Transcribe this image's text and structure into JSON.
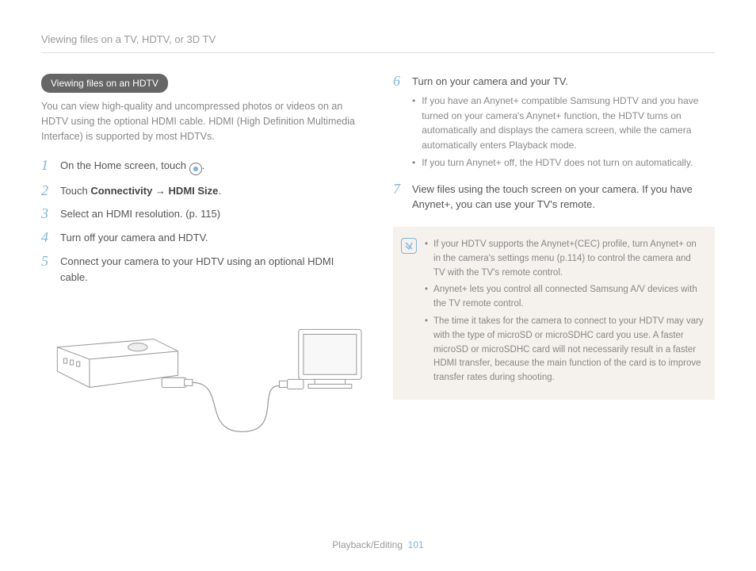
{
  "header": "Viewing files on a TV, HDTV, or 3D TV",
  "pill": "Viewing files on an HDTV",
  "intro": "You can view high-quality and uncompressed photos or videos on an HDTV using the optional HDMI cable. HDMI (High Definition Multimedia Interface) is supported by most HDTVs.",
  "steps": {
    "s1_a": "On the Home screen, touch ",
    "s1_b": ".",
    "s2_a": "Touch ",
    "s2_bold": "Connectivity → HDMI Size",
    "s2_b": ".",
    "s3": "Select an HDMI resolution. (p. 115)",
    "s4": "Turn off your camera and HDTV.",
    "s5": "Connect your camera to your HDTV using an optional HDMI cable.",
    "s6": "Turn on your camera and your TV.",
    "s6_sub1": "If you have an Anynet+ compatible Samsung HDTV and you have turned on your camera's Anynet+ function, the HDTV turns on automatically and displays the camera screen, while the camera automatically enters Playback mode.",
    "s6_sub2": "If you turn Anynet+ off, the HDTV does not turn on automatically.",
    "s7": "View files using the touch screen on your camera. If you have Anynet+, you can use your TV's remote."
  },
  "notes": {
    "n1": "If your HDTV supports the Anynet+(CEC) profile, turn Anynet+ on in the camera's settings menu (p.114) to control the camera and TV with the TV's remote control.",
    "n2": "Anynet+ lets you control all connected Samsung A/V devices with the TV remote control.",
    "n3": "The time it takes for the camera to connect to your HDTV may vary with the type of microSD or microSDHC card you use. A faster microSD or microSDHC card will not necessarily result in a faster HDMI transfer, because the main function of the card is to improve transfer rates during shooting."
  },
  "footer": {
    "section": "Playback/Editing",
    "page": "101"
  }
}
